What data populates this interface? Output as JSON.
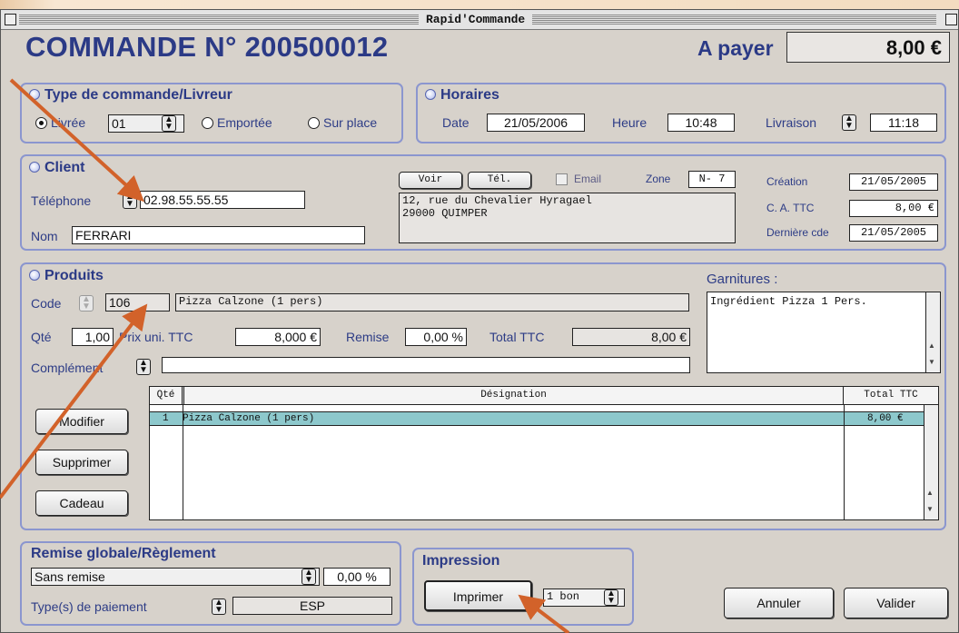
{
  "window": {
    "title": "Rapid'Commande"
  },
  "header": {
    "order_title": "COMMANDE N° 200500012",
    "apayer_label": "A payer",
    "apayer_value": "8,00 €"
  },
  "type_commande": {
    "title": "Type de commande/Livreur",
    "livree_label": "Livrée",
    "livreur_value": "01",
    "emportee_label": "Emportée",
    "surplace_label": "Sur place",
    "selected": "Livrée"
  },
  "horaires": {
    "title": "Horaires",
    "date_label": "Date",
    "date_value": "21/05/2006",
    "heure_label": "Heure",
    "heure_value": "10:48",
    "livraison_label": "Livraison",
    "livraison_value": "11:18"
  },
  "client": {
    "title": "Client",
    "telephone_label": "Téléphone",
    "telephone_value": "02.98.55.55.55",
    "nom_label": "Nom",
    "nom_value": "FERRARI",
    "voir_label": "Voir",
    "tel_label": "Tél.",
    "email_label": "Email",
    "zone_label": "Zone",
    "zone_value": "N- 7",
    "address_line1": "12, rue du Chevalier Hyragael",
    "address_line2": "29000 QUIMPER",
    "creation_label": "Création",
    "creation_value": "21/05/2005",
    "ca_label": "C. A. TTC",
    "ca_value": "8,00 €",
    "derniere_label": "Dernière cde",
    "derniere_value": "21/05/2005"
  },
  "produits": {
    "title": "Produits",
    "code_label": "Code",
    "code_value": "106",
    "product_name": "Pizza Calzone (1 pers)",
    "qte_label": "Qté",
    "qte_value": "1,00",
    "prix_label": "Prix uni. TTC",
    "prix_value": "8,000 €",
    "remise_label": "Remise",
    "remise_value": "0,00 %",
    "total_label": "Total TTC",
    "total_value": "8,00 €",
    "complement_label": "Complément",
    "complement_value": "",
    "garnitures_label": "Garnitures :",
    "garnitures_value": "Ingrédient Pizza 1 Pers."
  },
  "table": {
    "headers": [
      "Qté",
      "Désignation",
      "Total TTC"
    ],
    "rows": [
      {
        "qte": "1",
        "designation": "Pizza Calzone (1 pers)",
        "total": "8,00 €"
      }
    ]
  },
  "actions": {
    "modifier": "Modifier",
    "supprimer": "Supprimer",
    "cadeau": "Cadeau"
  },
  "remise_globale": {
    "title": "Remise globale/Règlement",
    "remise_select": "Sans remise",
    "remise_value": "0,00 %",
    "paiement_label": "Type(s) de paiement",
    "paiement_value": "ESP"
  },
  "impression": {
    "title": "Impression",
    "imprimer_label": "Imprimer",
    "bons_value": "1 bon"
  },
  "footer": {
    "annuler_label": "Annuler",
    "valider_label": "Valider"
  },
  "colors": {
    "accent": "#2b3a86",
    "group_border": "#8b96cf",
    "selected_row": "#8dc8cc",
    "arrow": "#d2622a"
  }
}
